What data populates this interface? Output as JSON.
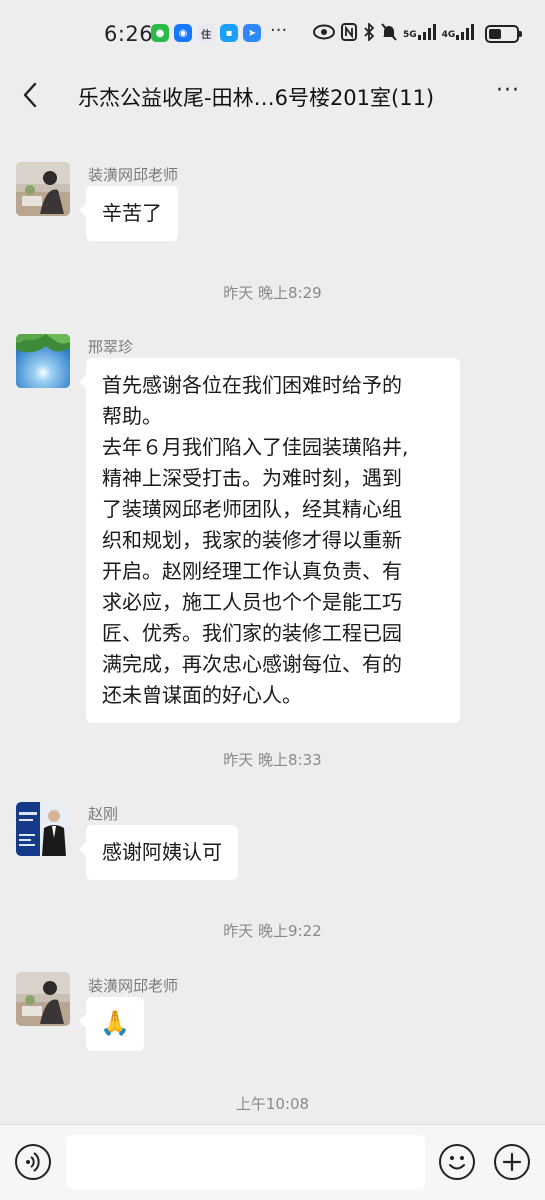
{
  "status_bar": {
    "time": "6:26",
    "more": "···",
    "network1": "5G",
    "network2": "4G"
  },
  "header": {
    "title": "乐杰公益收尾-田林…6号楼201室(11)",
    "more": "···"
  },
  "messages": [
    {
      "sender": "装潢网邱老师",
      "text": "辛苦了"
    },
    {
      "timestamp": "昨天 晚上8:29"
    },
    {
      "sender": "邢翠珍",
      "lines": [
        "首先感谢各位在我们困难时给予的",
        "帮助。",
        "去年６月我们陷入了佳园装璜陷井,",
        "精神上深受打击。为难时刻，遇到",
        "了装璜网邱老师团队，经其精心组",
        "织和规划，我家的装修才得以重新",
        "开启。赵刚经理工作认真负责、有",
        "求必应，施工人员也个个是能工巧",
        "匠、优秀。我们家的装修工程已园",
        "满完成，再次忠心感谢每位、有的",
        "还未曾谋面的好心人。"
      ]
    },
    {
      "timestamp": "昨天 晚上8:33"
    },
    {
      "sender": "赵刚",
      "text": "感谢阿姨认可"
    },
    {
      "timestamp": "昨天 晚上9:22"
    },
    {
      "sender": "装潢网邱老师",
      "emoji": "🙏"
    },
    {
      "timestamp": "上午10:08"
    }
  ],
  "colors": {
    "background": "#ededed",
    "bubble": "#ffffff",
    "timestamp": "#8a8a8a"
  },
  "icons": {
    "back": "chevron-left-icon",
    "voice": "voice-icon",
    "emoji": "emoji-icon",
    "plus": "plus-icon"
  }
}
